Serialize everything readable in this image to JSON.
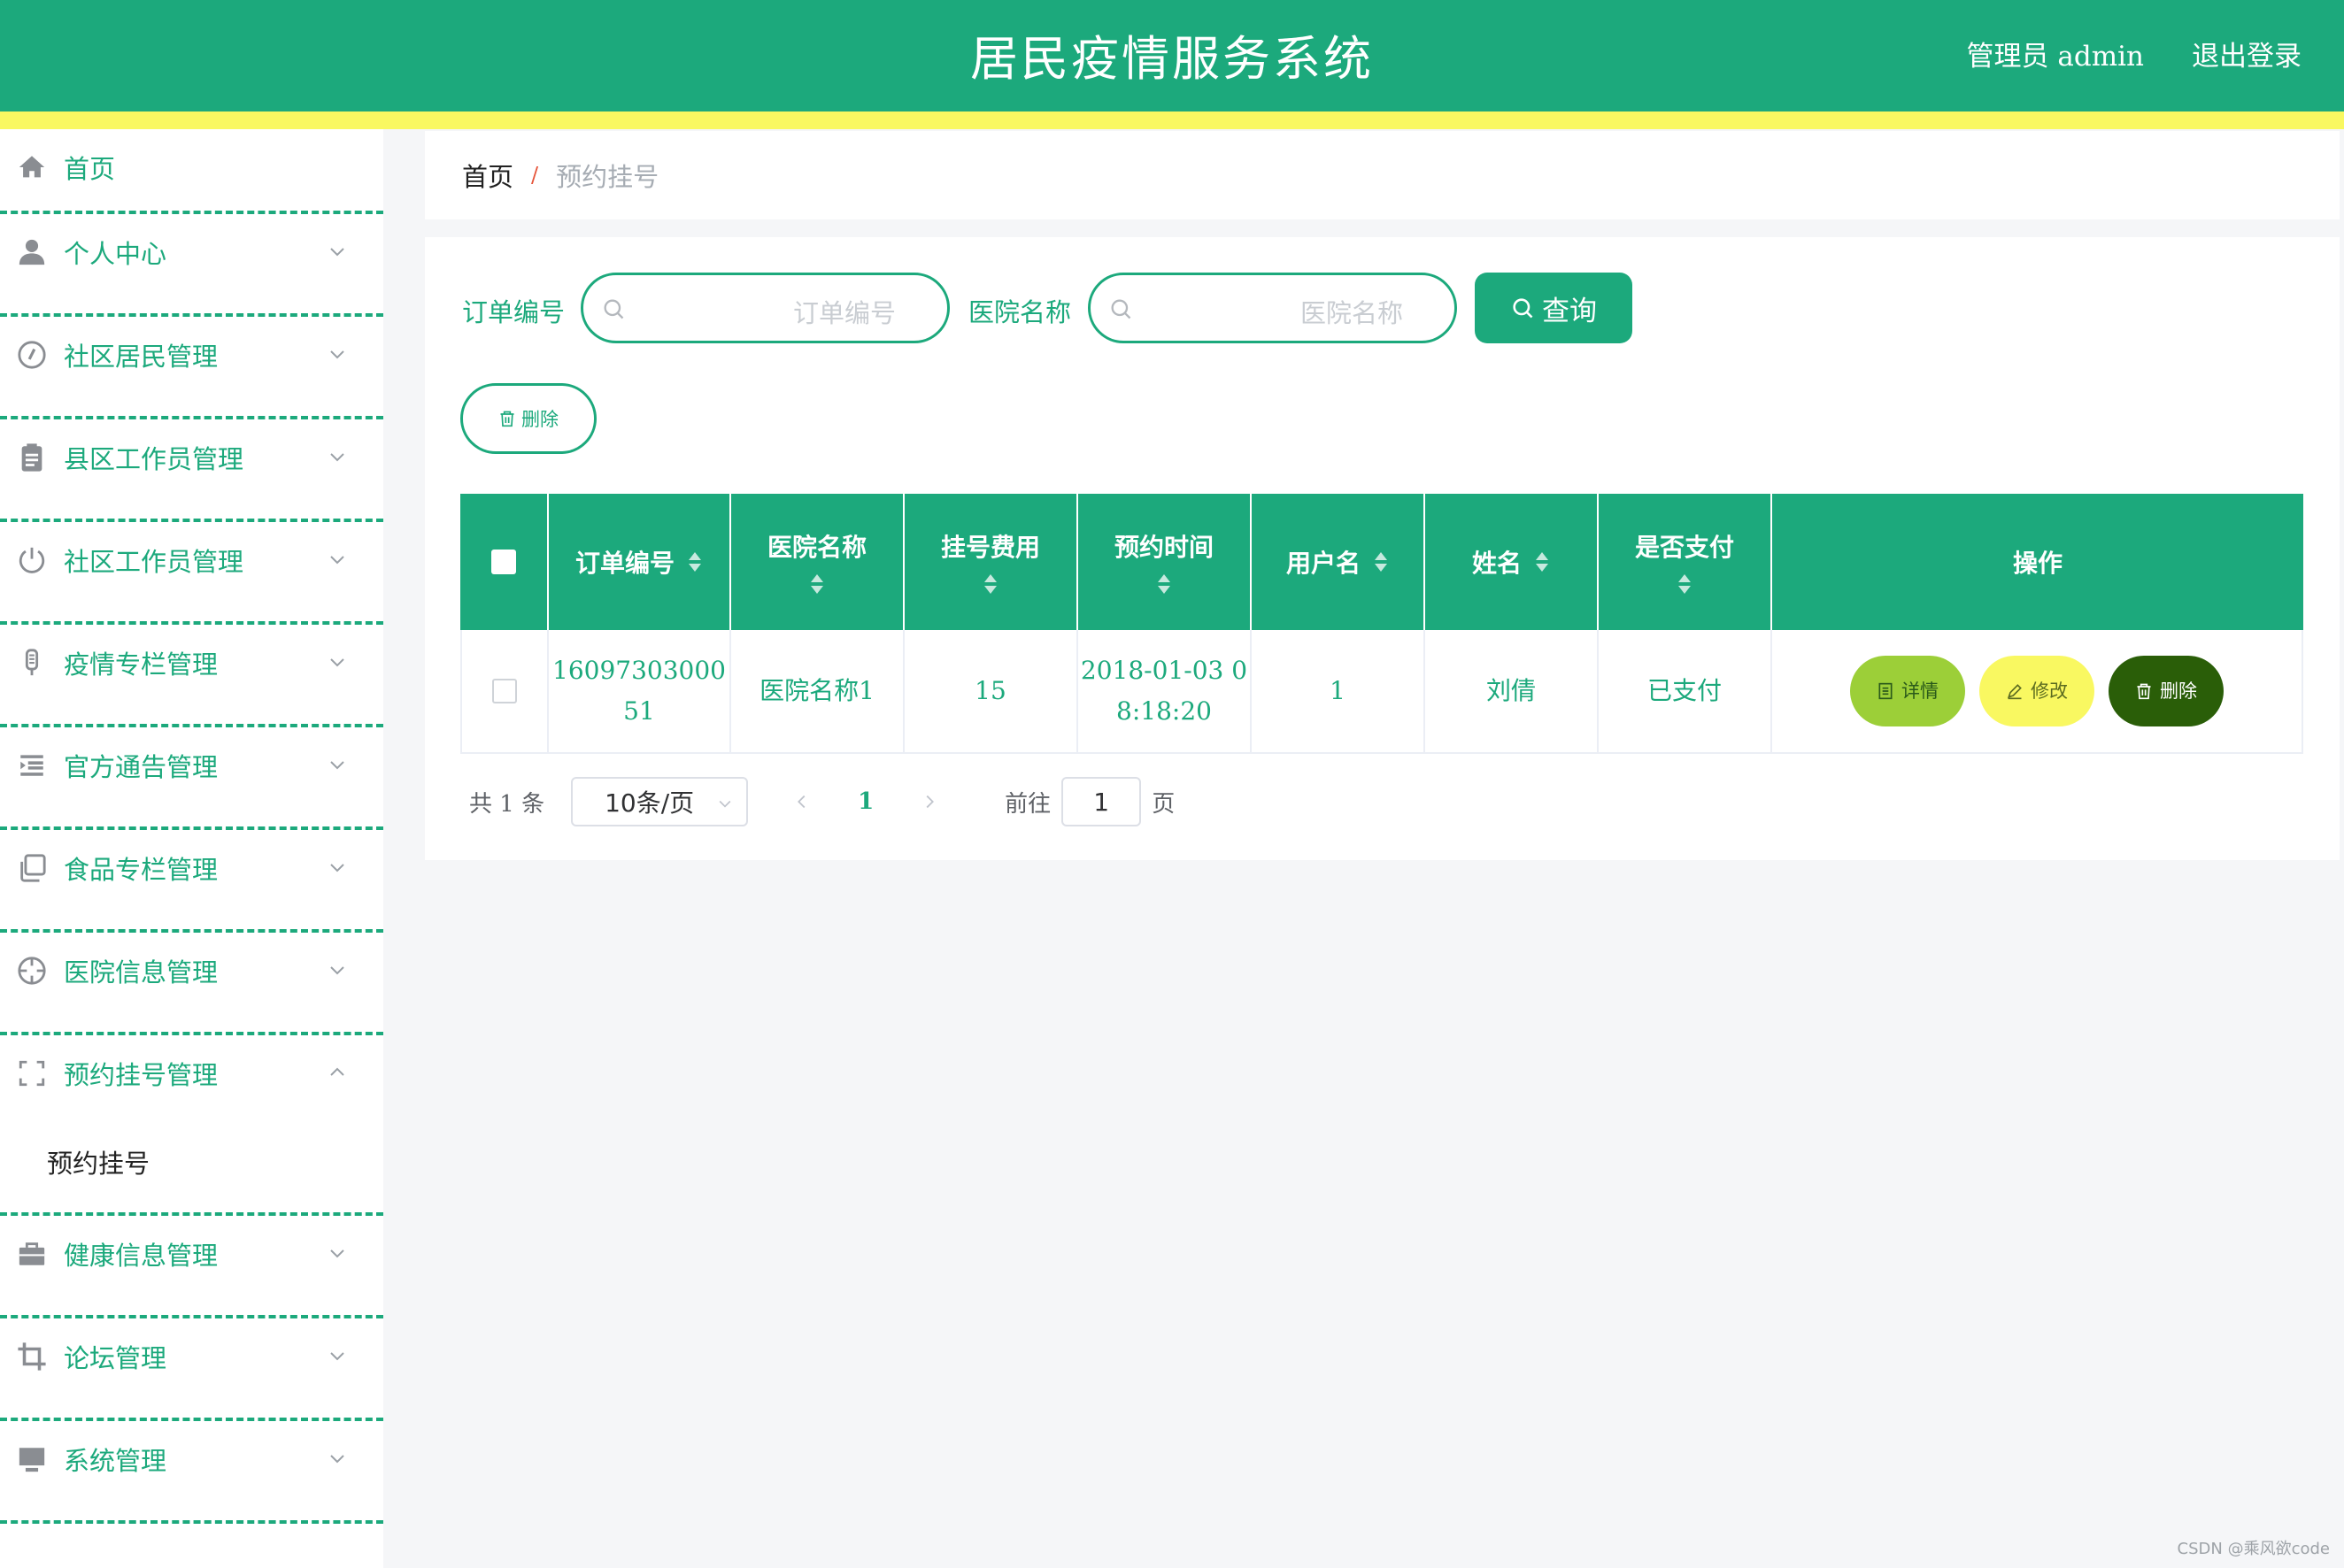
{
  "header": {
    "title": "居民疫情服务系统",
    "admin_label": "管理员 admin",
    "logout": "退出登录"
  },
  "sidebar": {
    "home": "首页",
    "items": [
      {
        "label": "个人中心",
        "icon": "user-icon"
      },
      {
        "label": "社区居民管理",
        "icon": "compass-icon"
      },
      {
        "label": "县区工作员管理",
        "icon": "clipboard-icon"
      },
      {
        "label": "社区工作员管理",
        "icon": "power-icon"
      },
      {
        "label": "疫情专栏管理",
        "icon": "thermometer-icon"
      },
      {
        "label": "官方通告管理",
        "icon": "list-indent-icon"
      },
      {
        "label": "食品专栏管理",
        "icon": "copy-icon"
      },
      {
        "label": "医院信息管理",
        "icon": "crosshair-icon"
      },
      {
        "label": "预约挂号管理",
        "icon": "frame-icon",
        "sub": "预约挂号"
      },
      {
        "label": "健康信息管理",
        "icon": "briefcase-icon"
      },
      {
        "label": "论坛管理",
        "icon": "crop-icon"
      },
      {
        "label": "系统管理",
        "icon": "monitor-icon"
      }
    ]
  },
  "breadcrumb": {
    "home": "首页",
    "separator": "/",
    "current": "预约挂号"
  },
  "search": {
    "order_label": "订单编号",
    "order_placeholder": "订单编号",
    "hospital_label": "医院名称",
    "hospital_placeholder": "医院名称",
    "query_button": "查询",
    "delete_button": "删除"
  },
  "table": {
    "headers": [
      "订单编号",
      "医院名称",
      "挂号费用",
      "预约时间",
      "用户名",
      "姓名",
      "是否支付",
      "操作"
    ],
    "rows": [
      {
        "order_no_line1": "16097303000",
        "order_no_line2": "51",
        "hospital": "医院名称1",
        "fee": "15",
        "time_line1": "2018-01-03 0",
        "time_line2": "8:18:20",
        "username": "1",
        "name": "刘倩",
        "paid": "已支付"
      }
    ],
    "actions": {
      "detail": "详情",
      "edit": "修改",
      "delete": "删除"
    }
  },
  "pagination": {
    "total": "共 1 条",
    "page_size": "10条/页",
    "current_page": "1",
    "goto_label": "前往",
    "goto_value": "1",
    "page_unit": "页"
  },
  "watermark": "CSDN @乘风欲code",
  "colors": {
    "primary": "#1ca97c",
    "stripe": "#f9f861",
    "detail_button": "#9ccf38",
    "edit_button": "#f9f861",
    "delete_button": "#2a5e08"
  }
}
